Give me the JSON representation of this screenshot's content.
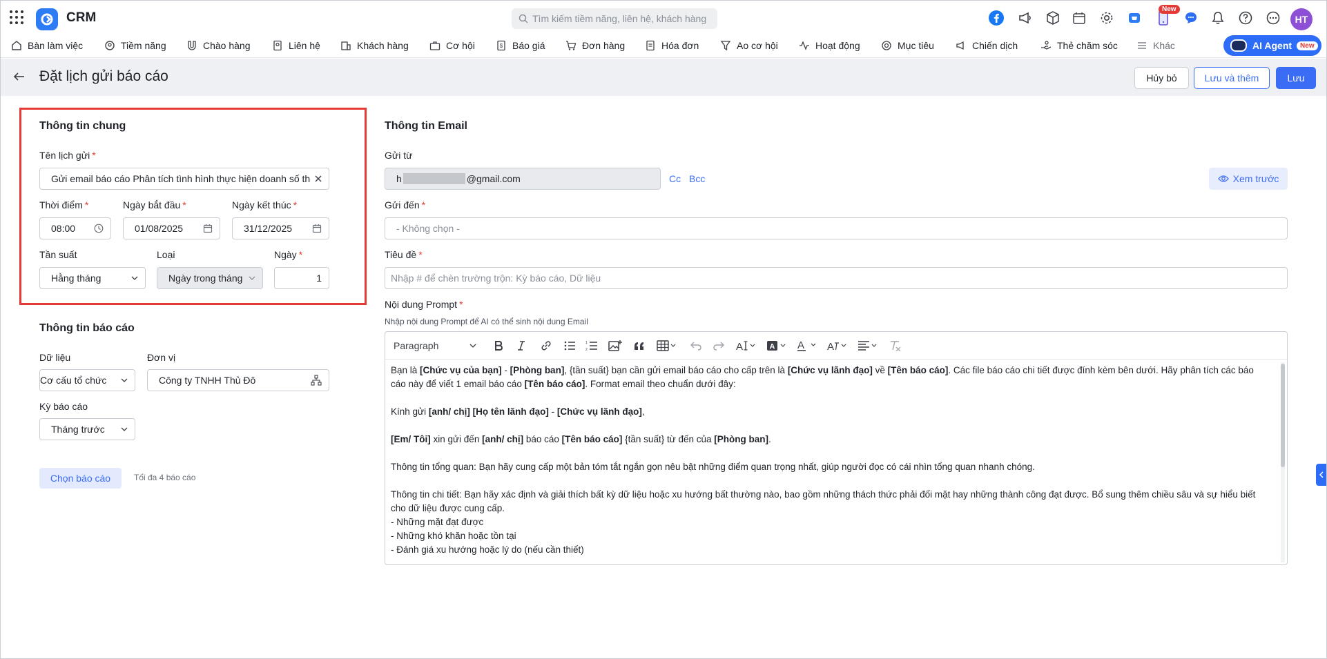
{
  "app": {
    "name": "CRM",
    "search_placeholder": "Tìm kiếm tiềm năng, liên hệ, khách hàng",
    "new_badge": "New",
    "avatar_initials": "HT",
    "brand_color": "#2c7cf6"
  },
  "nav": {
    "items": [
      {
        "label": "Bàn làm việc",
        "icon": "home-icon"
      },
      {
        "label": "Tiềm năng",
        "icon": "leads-icon"
      },
      {
        "label": "Chào hàng",
        "icon": "magnet-icon"
      },
      {
        "label": "Liên hệ",
        "icon": "contact-icon"
      },
      {
        "label": "Khách hàng",
        "icon": "building-icon"
      },
      {
        "label": "Cơ hội",
        "icon": "briefcase-icon"
      },
      {
        "label": "Báo giá",
        "icon": "quote-icon"
      },
      {
        "label": "Đơn hàng",
        "icon": "cart-icon"
      },
      {
        "label": "Hóa đơn",
        "icon": "invoice-icon"
      },
      {
        "label": "Ao cơ hội",
        "icon": "funnel-icon"
      },
      {
        "label": "Hoạt động",
        "icon": "activity-icon"
      },
      {
        "label": "Mục tiêu",
        "icon": "target-icon"
      },
      {
        "label": "Chiến dịch",
        "icon": "megaphone-icon"
      },
      {
        "label": "Thẻ chăm sóc",
        "icon": "care-icon"
      },
      {
        "label": "Khác",
        "icon": "menu-icon"
      }
    ],
    "ai_agent": {
      "label": "AI Agent",
      "badge": "New"
    }
  },
  "header": {
    "title": "Đặt lịch gửi báo cáo",
    "cancel_label": "Hủy bỏ",
    "save_add_label": "Lưu và thêm",
    "save_label": "Lưu"
  },
  "general": {
    "title": "Thông tin chung",
    "schedule_name_label": "Tên lịch gửi",
    "schedule_name_value": "Gửi email báo cáo Phân tích tình hình thực hiện doanh số theo",
    "time_label": "Thời điểm",
    "time_value": "08:00",
    "start_label": "Ngày bắt đầu",
    "start_value": "01/08/2025",
    "end_label": "Ngày kết thúc",
    "end_value": "31/12/2025",
    "freq_label": "Tần suất",
    "freq_value": "Hằng tháng",
    "type_label": "Loại",
    "type_value": "Ngày trong tháng",
    "day_label": "Ngày",
    "day_value": "1"
  },
  "report": {
    "title": "Thông tin báo cáo",
    "data_label": "Dữ liệu",
    "data_value": "Cơ cấu tổ chức",
    "unit_label": "Đơn vị",
    "unit_value": "Công ty TNHH Thủ Đô",
    "period_label": "Kỳ báo cáo",
    "period_value": "Tháng trước",
    "choose_label": "Chọn báo cáo",
    "choose_note": "Tối đa 4 báo cáo"
  },
  "email": {
    "title": "Thông tin Email",
    "from_label": "Gửi từ",
    "from_prefix": "h",
    "from_domain": "@gmail.com",
    "cc_label": "Cc",
    "bcc_label": "Bcc",
    "preview_label": "Xem trước",
    "to_label": "Gửi đến",
    "to_placeholder": "- Không chọn -",
    "subject_label": "Tiêu đề",
    "subject_placeholder": "Nhập # để chèn trường trộn: Kỳ báo cáo, Dữ liệu",
    "prompt_label": "Nội dung Prompt",
    "prompt_hint": "Nhập nội dung Prompt để AI có thể sinh nội dung Email",
    "paragraph_style": "Paragraph"
  },
  "prompt_lines": [
    [
      {
        "t": "Bạn là "
      },
      {
        "t": "[Chức vụ của bạn]",
        "b": true
      },
      {
        "t": " - "
      },
      {
        "t": "[Phòng ban]",
        "b": true
      },
      {
        "t": ", {tần suất} bạn cần gửi email báo cáo cho cấp trên là "
      },
      {
        "t": "[Chức vụ lãnh đạo]",
        "b": true
      },
      {
        "t": " về "
      },
      {
        "t": "[Tên báo cáo]",
        "b": true
      },
      {
        "t": ". Các file báo cáo chi tiết được đính kèm bên dưới. Hãy phân tích các báo"
      }
    ],
    [
      {
        "t": "cáo này để viết 1 email báo cáo "
      },
      {
        "t": "[Tên báo cáo]",
        "b": true
      },
      {
        "t": ". Format email theo chuẩn dưới đây:"
      }
    ],
    [],
    [
      {
        "t": "Kính gửi "
      },
      {
        "t": "[anh/ chị] [Họ tên lãnh đạo]",
        "b": true
      },
      {
        "t": " - "
      },
      {
        "t": "[Chức vụ lãnh đạo]",
        "b": true
      },
      {
        "t": ","
      }
    ],
    [],
    [
      {
        "t": "[Em/ Tôi]",
        "b": true
      },
      {
        "t": " xin gửi đến "
      },
      {
        "t": "[anh/ chị]",
        "b": true
      },
      {
        "t": " báo cáo "
      },
      {
        "t": "[Tên báo cáo]",
        "b": true
      },
      {
        "t": " {tần suất} từ đến của "
      },
      {
        "t": "[Phòng ban]",
        "b": true
      },
      {
        "t": "."
      }
    ],
    [],
    [
      {
        "t": "Thông tin tổng quan: Bạn hãy cung cấp một bản tóm tắt ngắn gọn nêu bật những điểm quan trọng nhất, giúp người đọc có cái nhìn tổng quan nhanh chóng."
      }
    ],
    [],
    [
      {
        "t": "Thông tin chi tiết: Bạn hãy xác định và giải thích bất kỳ dữ liệu hoặc xu hướng bất thường nào, bao gồm những thách thức phải đối mặt hay những thành công đạt được. Bổ sung thêm chiều sâu và sự hiểu biết"
      }
    ],
    [
      {
        "t": "cho dữ liệu được cung cấp."
      }
    ],
    [
      {
        "t": "- Những mặt đạt được"
      }
    ],
    [
      {
        "t": "- Những khó khăn hoặc tồn tại"
      }
    ],
    [
      {
        "t": "- Đánh giá xu hướng hoặc lý do (nếu cần thiết)"
      }
    ]
  ]
}
